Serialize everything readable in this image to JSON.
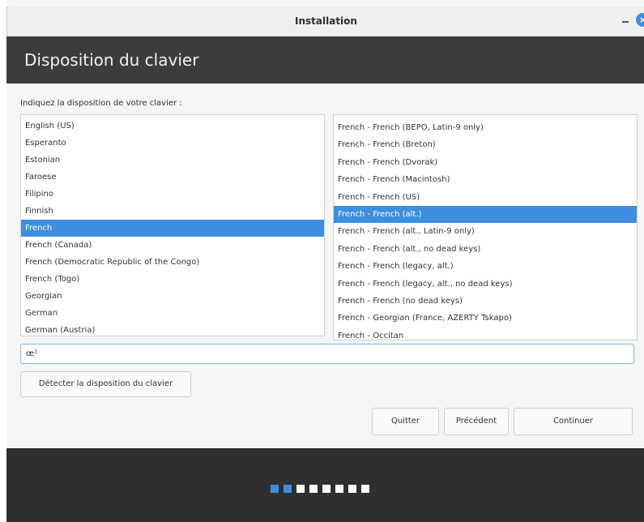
{
  "window": {
    "title": "Installation",
    "close_icon": "×"
  },
  "header": {
    "title": "Disposition du clavier"
  },
  "main": {
    "prompt": "Indiquez la disposition de votre clavier :",
    "layouts": [
      {
        "label": "English (US)",
        "selected": false
      },
      {
        "label": "Esperanto",
        "selected": false
      },
      {
        "label": "Estonian",
        "selected": false
      },
      {
        "label": "Faroese",
        "selected": false
      },
      {
        "label": "Filipino",
        "selected": false
      },
      {
        "label": "Finnish",
        "selected": false
      },
      {
        "label": "French",
        "selected": true
      },
      {
        "label": "French (Canada)",
        "selected": false
      },
      {
        "label": "French (Democratic Republic of the Congo)",
        "selected": false
      },
      {
        "label": "French (Togo)",
        "selected": false
      },
      {
        "label": "Georgian",
        "selected": false
      },
      {
        "label": "German",
        "selected": false
      },
      {
        "label": "German (Austria)",
        "selected": false
      }
    ],
    "variants": [
      {
        "label": "French - French (BEPO, Latin-9 only)",
        "selected": false
      },
      {
        "label": "French - French (Breton)",
        "selected": false
      },
      {
        "label": "French - French (Dvorak)",
        "selected": false
      },
      {
        "label": "French - French (Macintosh)",
        "selected": false
      },
      {
        "label": "French - French (US)",
        "selected": false
      },
      {
        "label": "French - French (alt.)",
        "selected": true
      },
      {
        "label": "French - French (alt., Latin-9 only)",
        "selected": false
      },
      {
        "label": "French - French (alt., no dead keys)",
        "selected": false
      },
      {
        "label": "French - French (legacy, alt.)",
        "selected": false
      },
      {
        "label": "French - French (legacy, alt., no dead keys)",
        "selected": false
      },
      {
        "label": "French - French (no dead keys)",
        "selected": false
      },
      {
        "label": "French - Georgian (France, AZERTY Tskapo)",
        "selected": false
      },
      {
        "label": "French - Occitan",
        "selected": false
      }
    ],
    "test_input_value": "œ¹",
    "detect_label": "Détecter la disposition du clavier"
  },
  "buttons": {
    "quit_label": "Quitter",
    "previous_label": "Précédent",
    "continue_label": "Continuer"
  },
  "footer": {
    "total_steps": 8,
    "active_steps": 2
  },
  "colors": {
    "accent": "#3d8ee0",
    "header_bg": "#3c3c3c",
    "footer_bg": "#2f2f2f"
  }
}
